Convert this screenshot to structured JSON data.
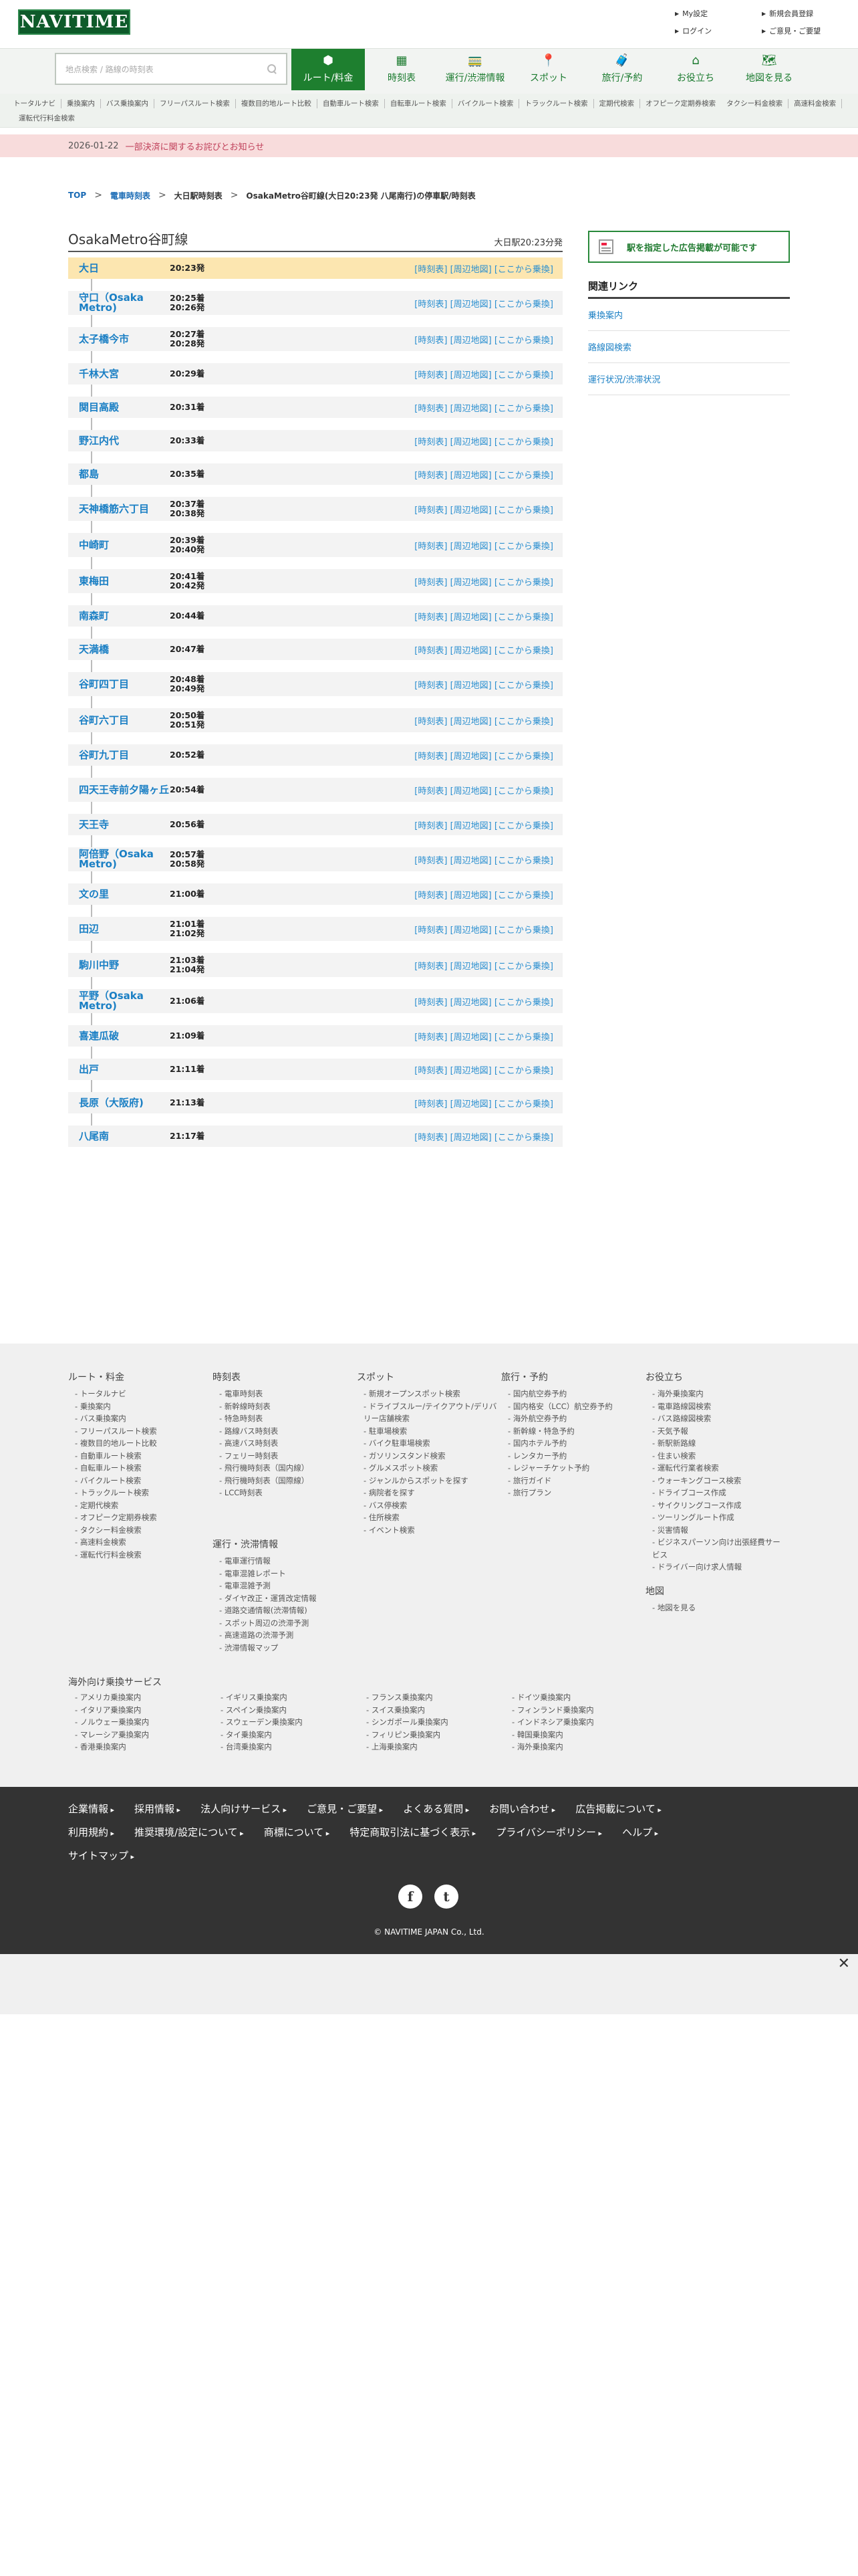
{
  "header": {
    "logo": "NAVITIME",
    "links": [
      "My設定",
      "新規会員登録",
      "ログイン",
      "ご意見・ご要望"
    ]
  },
  "search": {
    "placeholder": "地点検索 / 路線の時刻表"
  },
  "nav_tabs": [
    {
      "label": "ルート/料金",
      "icon": "route-icon",
      "glyph": "⬢",
      "active": true
    },
    {
      "label": "時刻表",
      "icon": "timetable-icon",
      "glyph": "▦",
      "active": false
    },
    {
      "label": "運行/渋滞情報",
      "icon": "train-bus-icon",
      "glyph": "🚃",
      "active": false
    },
    {
      "label": "スポット",
      "icon": "map-pin-icon",
      "glyph": "📍",
      "active": false
    },
    {
      "label": "旅行/予約",
      "icon": "suitcase-icon",
      "glyph": "🧳",
      "active": false
    },
    {
      "label": "お役立ち",
      "icon": "house-icon",
      "glyph": "⌂",
      "active": false
    },
    {
      "label": "地図を見る",
      "icon": "map-person-icon",
      "glyph": "🗺",
      "active": false
    }
  ],
  "subnav": [
    "トータルナビ",
    "乗換案内",
    "バス乗換案内",
    "フリーパスルート検索",
    "複数目的地ルート比較",
    "自動車ルート検索",
    "自転車ルート検索",
    "バイクルート検索",
    "トラックルート検索",
    "定期代検索",
    "オフピーク定期券検索",
    "タクシー料金検索",
    "高速料金検索",
    "運転代行料金検索"
  ],
  "notice": {
    "date": "2026-01-22",
    "text": "一部決済に関するお詫びとお知らせ"
  },
  "breadcrumb": [
    "TOP",
    "電車時刻表",
    "大日駅時刻表",
    "OsakaMetro谷町線(大日20:23発 八尾南行)の停車駅/時刻表"
  ],
  "route": {
    "title": "OsakaMetro谷町線",
    "departure": "大日駅20:23分発",
    "links_text": "[時刻表] [周辺地図] [ここから乗換]"
  },
  "stops": [
    {
      "name": "大日",
      "times": [
        "20:23発"
      ]
    },
    {
      "name": "守口（Osaka Metro)",
      "times": [
        "20:25着",
        "20:26発"
      ]
    },
    {
      "name": "太子橋今市",
      "times": [
        "20:27着",
        "20:28発"
      ]
    },
    {
      "name": "千林大宮",
      "times": [
        "20:29着"
      ]
    },
    {
      "name": "関目高殿",
      "times": [
        "20:31着"
      ]
    },
    {
      "name": "野江内代",
      "times": [
        "20:33着"
      ]
    },
    {
      "name": "都島",
      "times": [
        "20:35着"
      ]
    },
    {
      "name": "天神橋筋六丁目",
      "times": [
        "20:37着",
        "20:38発"
      ]
    },
    {
      "name": "中崎町",
      "times": [
        "20:39着",
        "20:40発"
      ]
    },
    {
      "name": "東梅田",
      "times": [
        "20:41着",
        "20:42発"
      ]
    },
    {
      "name": "南森町",
      "times": [
        "20:44着"
      ]
    },
    {
      "name": "天満橋",
      "times": [
        "20:47着"
      ]
    },
    {
      "name": "谷町四丁目",
      "times": [
        "20:48着",
        "20:49発"
      ]
    },
    {
      "name": "谷町六丁目",
      "times": [
        "20:50着",
        "20:51発"
      ]
    },
    {
      "name": "谷町九丁目",
      "times": [
        "20:52着"
      ]
    },
    {
      "name": "四天王寺前夕陽ヶ丘",
      "times": [
        "20:54着"
      ]
    },
    {
      "name": "天王寺",
      "times": [
        "20:56着"
      ]
    },
    {
      "name": "阿倍野（Osaka Metro)",
      "times": [
        "20:57着",
        "20:58発"
      ]
    },
    {
      "name": "文の里",
      "times": [
        "21:00着"
      ]
    },
    {
      "name": "田辺",
      "times": [
        "21:01着",
        "21:02発"
      ]
    },
    {
      "name": "駒川中野",
      "times": [
        "21:03着",
        "21:04発"
      ]
    },
    {
      "name": "平野（Osaka Metro)",
      "times": [
        "21:06着"
      ]
    },
    {
      "name": "喜連瓜破",
      "times": [
        "21:09着"
      ]
    },
    {
      "name": "出戸",
      "times": [
        "21:11着"
      ]
    },
    {
      "name": "長原（大阪府)",
      "times": [
        "21:13着"
      ]
    },
    {
      "name": "八尾南",
      "times": [
        "21:17着"
      ]
    }
  ],
  "sidebar": {
    "ad_text": "駅を指定した広告掲載が可能です",
    "related_title": "関連リンク",
    "related_links": [
      "乗換案内",
      "路線図検索",
      "運行状況/渋滞状況"
    ]
  },
  "footer": {
    "columns": [
      {
        "title": "ルート・料金",
        "items": [
          "トータルナビ",
          "乗換案内",
          "バス乗換案内",
          "フリーパスルート検索",
          "複数目的地ルート比較",
          "自動車ルート検索",
          "自転車ルート検索",
          "バイクルート検索",
          "トラックルート検索",
          "定期代検索",
          "オフピーク定期券検索",
          "タクシー料金検索",
          "高速料金検索",
          "運転代行料金検索"
        ]
      },
      {
        "title": "時刻表",
        "items": [
          "電車時刻表",
          "新幹線時刻表",
          "特急時刻表",
          "路線バス時刻表",
          "高速バス時刻表",
          "フェリー時刻表",
          "飛行機時刻表（国内線）",
          "飛行機時刻表（国際線）",
          "LCC時刻表"
        ]
      },
      {
        "title": "運行・渋滞情報",
        "items": [
          "電車運行情報",
          "電車混雑レポート",
          "電車混雑予測",
          "ダイヤ改正・運賃改定情報",
          "道路交通情報(渋滞情報)",
          "スポット周辺の渋滞予測",
          "高速道路の渋滞予測",
          "渋滞情報マップ"
        ]
      },
      {
        "title": "スポット",
        "items": [
          "新規オープンスポット検索",
          "ドライブスルー/テイクアウト/デリバリー店舗検索",
          "駐車場検索",
          "バイク駐車場検索",
          "ガソリンスタンド検索",
          "グルメスポット検索",
          "ジャンルからスポットを探す",
          "病院者を探す",
          "バス停検索",
          "住所検索",
          "イベント検索"
        ]
      },
      {
        "title": "旅行・予約",
        "items": [
          "国内航空券予約",
          "国内格安（LCC）航空券予約",
          "海外航空券予約",
          "新幹線・特急予約",
          "国内ホテル予約",
          "レンタカー予約",
          "レジャーチケット予約",
          "旅行ガイド",
          "旅行プラン"
        ]
      },
      {
        "title": "お役立ち",
        "items": [
          "海外乗換案内",
          "電車路線図検索",
          "バス路線図検索",
          "天気予報",
          "新駅新路線",
          "住まい検索",
          "運転代行業者検索",
          "ウォーキングコース検索",
          "ドライブコース作成",
          "サイクリングコース作成",
          "ツーリングルート作成",
          "災害情報",
          "ビジネスパーソン向け出張経費サービス",
          "ドライバー向け求人情報"
        ]
      },
      {
        "title": "地図",
        "items": [
          "地図を見る"
        ]
      }
    ],
    "overseas_title": "海外向け乗換サービス",
    "overseas": [
      "アメリカ乗換案内",
      "イギリス乗換案内",
      "フランス乗換案内",
      "ドイツ乗換案内",
      "イタリア乗換案内",
      "スペイン乗換案内",
      "スイス乗換案内",
      "フィンランド乗換案内",
      "ノルウェー乗換案内",
      "スウェーデン乗換案内",
      "シンガポール乗換案内",
      "インドネシア乗換案内",
      "マレーシア乗換案内",
      "タイ乗換案内",
      "フィリピン乗換案内",
      "韓国乗換案内",
      "香港乗換案内",
      "台湾乗換案内",
      "上海乗換案内",
      "海外乗換案内"
    ],
    "bottom_links": [
      "企業情報",
      "採用情報",
      "法人向けサービス",
      "ご意見・ご要望",
      "よくある質問",
      "お問い合わせ",
      "広告掲載について",
      "利用規約",
      "推奨環境/設定について",
      "商標について",
      "特定商取引法に基づく表示",
      "プライバシーポリシー",
      "ヘルプ",
      "サイトマップ"
    ],
    "social": [
      "f",
      "t"
    ],
    "copyright": "© NAVITIME JAPAN Co., Ltd."
  },
  "adstrip": {
    "close": "✕"
  }
}
